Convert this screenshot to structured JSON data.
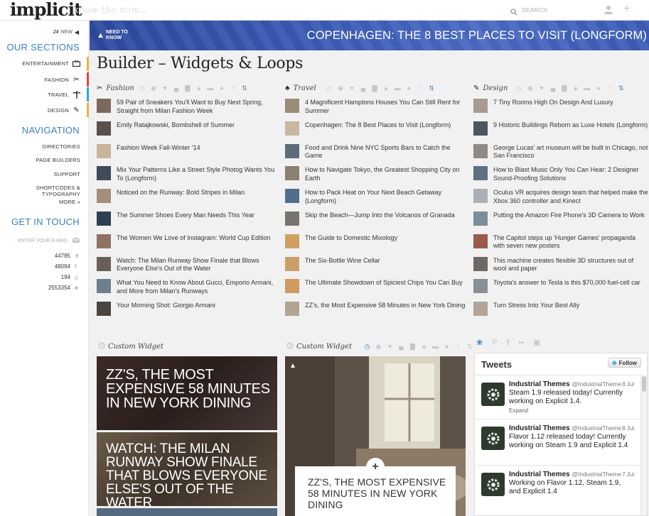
{
  "header": {
    "logo": "implicit",
    "tagline": "know the now...",
    "search_placeholder": "SEARCH"
  },
  "sidebar": {
    "news_count": "24",
    "news_label": "NEW",
    "sections_heading": "OUR SECTIONS",
    "sections": [
      {
        "label": "ENTERTAINMENT",
        "icon": "tv-icon",
        "color": "#f0b23a"
      },
      {
        "label": "FASHION",
        "icon": "scissors-icon",
        "color": "#e0453a"
      },
      {
        "label": "TRAVEL",
        "icon": "palm-tree-icon",
        "color": "#2ba6d9"
      },
      {
        "label": "DESIGN",
        "icon": "pencil-icon",
        "color": "#f0b23a"
      }
    ],
    "nav_heading": "NAVIGATION",
    "nav": [
      "DIRECTORIES",
      "PAGE BUILDERS",
      "SUPPORT",
      "SHORTCODES & TYPOGRAPHY",
      "MORE »"
    ],
    "touch_heading": "GET IN TOUCH",
    "email_placeholder": "ENTER YOUR E-MAIL",
    "stats": [
      {
        "value": "44785",
        "icon": "twitter-icon"
      },
      {
        "value": "48094",
        "icon": "facebook-icon"
      },
      {
        "value": "194",
        "icon": "google-plus-icon"
      },
      {
        "value": "2553354",
        "icon": "linkedin-icon"
      }
    ]
  },
  "banner": {
    "ntk_line1": "NEED TO",
    "ntk_line2": "KNOW",
    "title": "COPENHAGEN: THE 8 BEST PLACES TO VISIT (LONGFORM)"
  },
  "page": {
    "title": "Builder – Widgets & Loops"
  },
  "columns": [
    {
      "category": "Fashion",
      "icon": "scissors-icon",
      "items": [
        "59 Pair of Sneakers You'll Want to Buy Next Spring, Straight from Milan Fashion Week",
        "Emily Ratajkowski, Bombshell of Summer",
        "Fashion Week Fall-Winter '14",
        "Mix Your Patterns Like a Street Style Photog Wants You To (Longform)",
        "Noticed on the Runway: Bold Stripes in Milan",
        "The Summer Shoes Every Man Needs This Year",
        "The Women We Love of Instagram: World Cup Edition",
        "Watch: The Milan Runway Show Finale that Blows Everyone Else's Out of the Water",
        "What You Need to Know About Gucci, Emporio Armani, and More from Milan's Runways",
        "Your Morning Shot: Giorgio Armani"
      ]
    },
    {
      "category": "Travel",
      "icon": "palm-tree-icon",
      "items": [
        "4 Magnificent Hamptons Houses You Can Still Rent for Summer",
        "Copenhagen: The 8 Best Places to Visit (Longform)",
        "Food and Drink Nine NYC Sports Bars to Catch the Game",
        "How to Navigate Tokyo, the Greatest Shopping City on Earth",
        "How to Pack Heat on Your Next Beach Getaway (Longform)",
        "Skip the Beach—Jump Into the Volcanos of Granada",
        "The Guide to Domestic Mixology",
        "The Six-Bottle Wine Cellar",
        "The Ultimate Showdown of Spiciest Chips You Can Buy",
        "ZZ's, the Most Expensive 58 Minutes in New York Dining"
      ]
    },
    {
      "category": "Design",
      "icon": "pencil-icon",
      "items": [
        "7 Tiny Rooms High On Design And Luxury",
        "9 Historic Buildings Reborn as Luxe Hotels (Longform)",
        "George Lucas' art museum will be built in Chicago, not San Francisco",
        "How to Blast Music Only You Can Hear: 2 Designer Sound-Proofing Solutions",
        "Oculus VR acquires design team that helped make the Xbox 360 controller and Kinect",
        "Putting the Amazon Fire Phone's 3D Camera to Work",
        "The Capitol steps up 'Hunger Games' propaganda with seven new posters",
        "This machine creates flexible 3D structures out of wool and paper",
        "Toyota's answer to Tesla is this $70,000 fuel-cell car",
        "Turn Stress Into Your Best Ally"
      ]
    }
  ],
  "widgets": {
    "left_title": "Custom Widget",
    "middle_title": "Custom Widget",
    "cards": [
      "ZZ'S, THE MOST EXPENSIVE 58 MINUTES IN NEW YORK DINING",
      "WATCH: THE MILAN RUNWAY SHOW FINALE THAT BLOWS EVERYONE ELSE'S OUT OF THE WATER"
    ],
    "photo_caption": "ZZ'S, THE MOST EXPENSIVE 58 MINUTES IN NEW YORK DINING"
  },
  "tweets": {
    "heading": "Tweets",
    "follow": "Follow",
    "items": [
      {
        "name": "Industrial Themes",
        "handle": "@IndustrialTheme",
        "date": "8 Jul",
        "text": "Steam 1.9 released today! Currently working on Explicit 1.4.",
        "extra": "Expand"
      },
      {
        "name": "Industrial Themes",
        "handle": "@IndustrialTheme",
        "date": "8 Jul",
        "text": "Flavor 1.12 released today! Currently working on Steam 1.9 and Explicit 1.4",
        "extra": ""
      },
      {
        "name": "Industrial Themes",
        "handle": "@IndustrialTheme",
        "date": "7 Jul",
        "text": "Working on Flavor 1.12, Steam 1.9, and Explicit 1.4",
        "extra": ""
      }
    ]
  },
  "colors": {
    "accent": "#3a7fc1",
    "banner": "#3a5bb5"
  }
}
